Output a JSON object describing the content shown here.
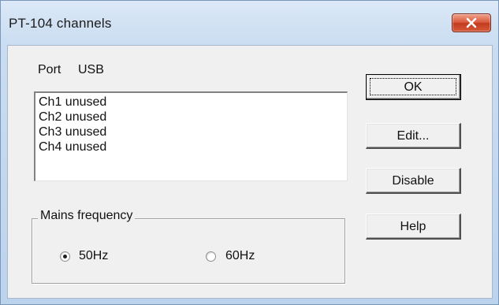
{
  "window": {
    "title": "PT-104 channels"
  },
  "port": {
    "label": "Port",
    "value": "USB"
  },
  "channels": [
    "Ch1 unused",
    "Ch2 unused",
    "Ch3 unused",
    "Ch4 unused"
  ],
  "mains": {
    "label": "Mains frequency",
    "options": [
      {
        "label": "50Hz",
        "selected": true
      },
      {
        "label": "60Hz",
        "selected": false
      }
    ]
  },
  "buttons": {
    "ok": "OK",
    "edit": "Edit...",
    "disable": "Disable",
    "help": "Help"
  },
  "icons": {
    "close": "close-icon"
  }
}
